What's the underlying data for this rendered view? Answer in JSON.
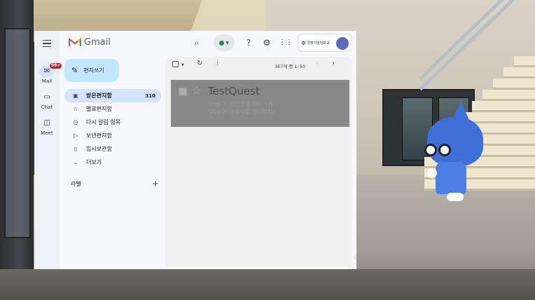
{
  "app": {
    "brand": "Gmail"
  },
  "rail": {
    "items": [
      {
        "label": "Mail",
        "icon": "inbox-icon",
        "badge": "99+",
        "active": true
      },
      {
        "label": "Chat",
        "icon": "chat-icon"
      },
      {
        "label": "Meet",
        "icon": "video-icon"
      }
    ]
  },
  "header": {
    "status_color": "#1e8e3e",
    "account_org": "국방기관대학교"
  },
  "compose": {
    "label": "편지쓰기"
  },
  "nav": {
    "items": [
      {
        "label": "받은편지함",
        "icon": "inbox-icon",
        "count": "310",
        "active": true
      },
      {
        "label": "별표편지함",
        "icon": "star-icon"
      },
      {
        "label": "다시 알림 항목",
        "icon": "clock-icon"
      },
      {
        "label": "보낸편지함",
        "icon": "send-icon"
      },
      {
        "label": "임시보관함",
        "icon": "draft-icon"
      },
      {
        "label": "더보기",
        "icon": "chevron-down-icon"
      }
    ],
    "labels_heading": "라벨"
  },
  "toolbar": {
    "page_info": "367개 중 1–50"
  },
  "mail": {
    "rows": [
      {
        "subject": "TestQuest",
        "line1": "Step 1: 명신관을 찾아가자",
        "line2": "Step 2: 눈송이를 만나보자!"
      }
    ]
  },
  "colors": {
    "compose_bg": "#c2e7ff",
    "active_nav_bg": "#d3e3fd",
    "badge_red": "#c5221f"
  }
}
